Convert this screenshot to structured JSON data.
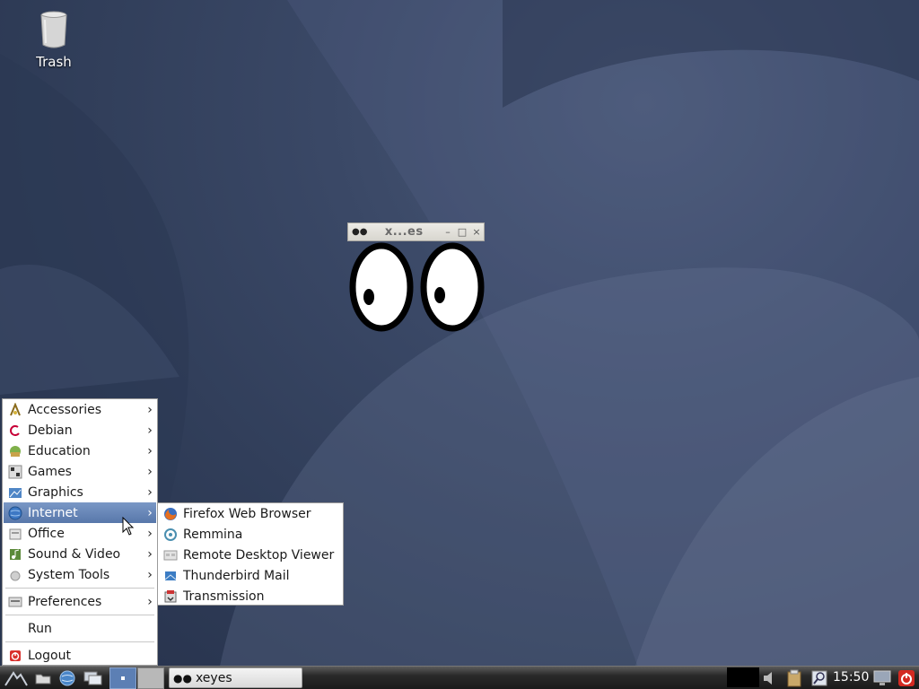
{
  "desktop": {
    "icons": [
      {
        "label": "Trash",
        "icon": "trash-icon"
      }
    ]
  },
  "xeyes_window": {
    "title": "x...es",
    "buttons": {
      "minimize": "–",
      "maximize": "□",
      "close": "×"
    }
  },
  "start_menu": {
    "items": [
      {
        "label": "Accessories",
        "icon": "accessories-icon",
        "has_submenu": true
      },
      {
        "label": "Debian",
        "icon": "debian-icon",
        "has_submenu": true
      },
      {
        "label": "Education",
        "icon": "education-icon",
        "has_submenu": true
      },
      {
        "label": "Games",
        "icon": "games-icon",
        "has_submenu": true
      },
      {
        "label": "Graphics",
        "icon": "graphics-icon",
        "has_submenu": true
      },
      {
        "label": "Internet",
        "icon": "internet-icon",
        "has_submenu": true,
        "active": true
      },
      {
        "label": "Office",
        "icon": "office-icon",
        "has_submenu": true
      },
      {
        "label": "Sound & Video",
        "icon": "sound-video-icon",
        "has_submenu": true
      },
      {
        "label": "System Tools",
        "icon": "system-tools-icon",
        "has_submenu": true
      },
      {
        "label": "Preferences",
        "icon": "preferences-icon",
        "has_submenu": true
      },
      {
        "label": "Run",
        "icon": "",
        "has_submenu": false
      },
      {
        "label": "Logout",
        "icon": "logout-icon",
        "has_submenu": false
      }
    ],
    "arrow": "›"
  },
  "internet_submenu": {
    "items": [
      {
        "label": "Firefox Web Browser",
        "icon": "firefox-icon"
      },
      {
        "label": "Remmina",
        "icon": "remmina-icon"
      },
      {
        "label": "Remote Desktop Viewer",
        "icon": "remote-desktop-icon"
      },
      {
        "label": "Thunderbird Mail",
        "icon": "thunderbird-icon"
      },
      {
        "label": "Transmission",
        "icon": "transmission-icon"
      }
    ]
  },
  "taskbar": {
    "task_label": "xeyes",
    "clock": "15:50"
  },
  "colors": {
    "menu_highlight": "#5f7eb0",
    "taskbar": "#1f1f1f",
    "desktop": "#34425f"
  }
}
